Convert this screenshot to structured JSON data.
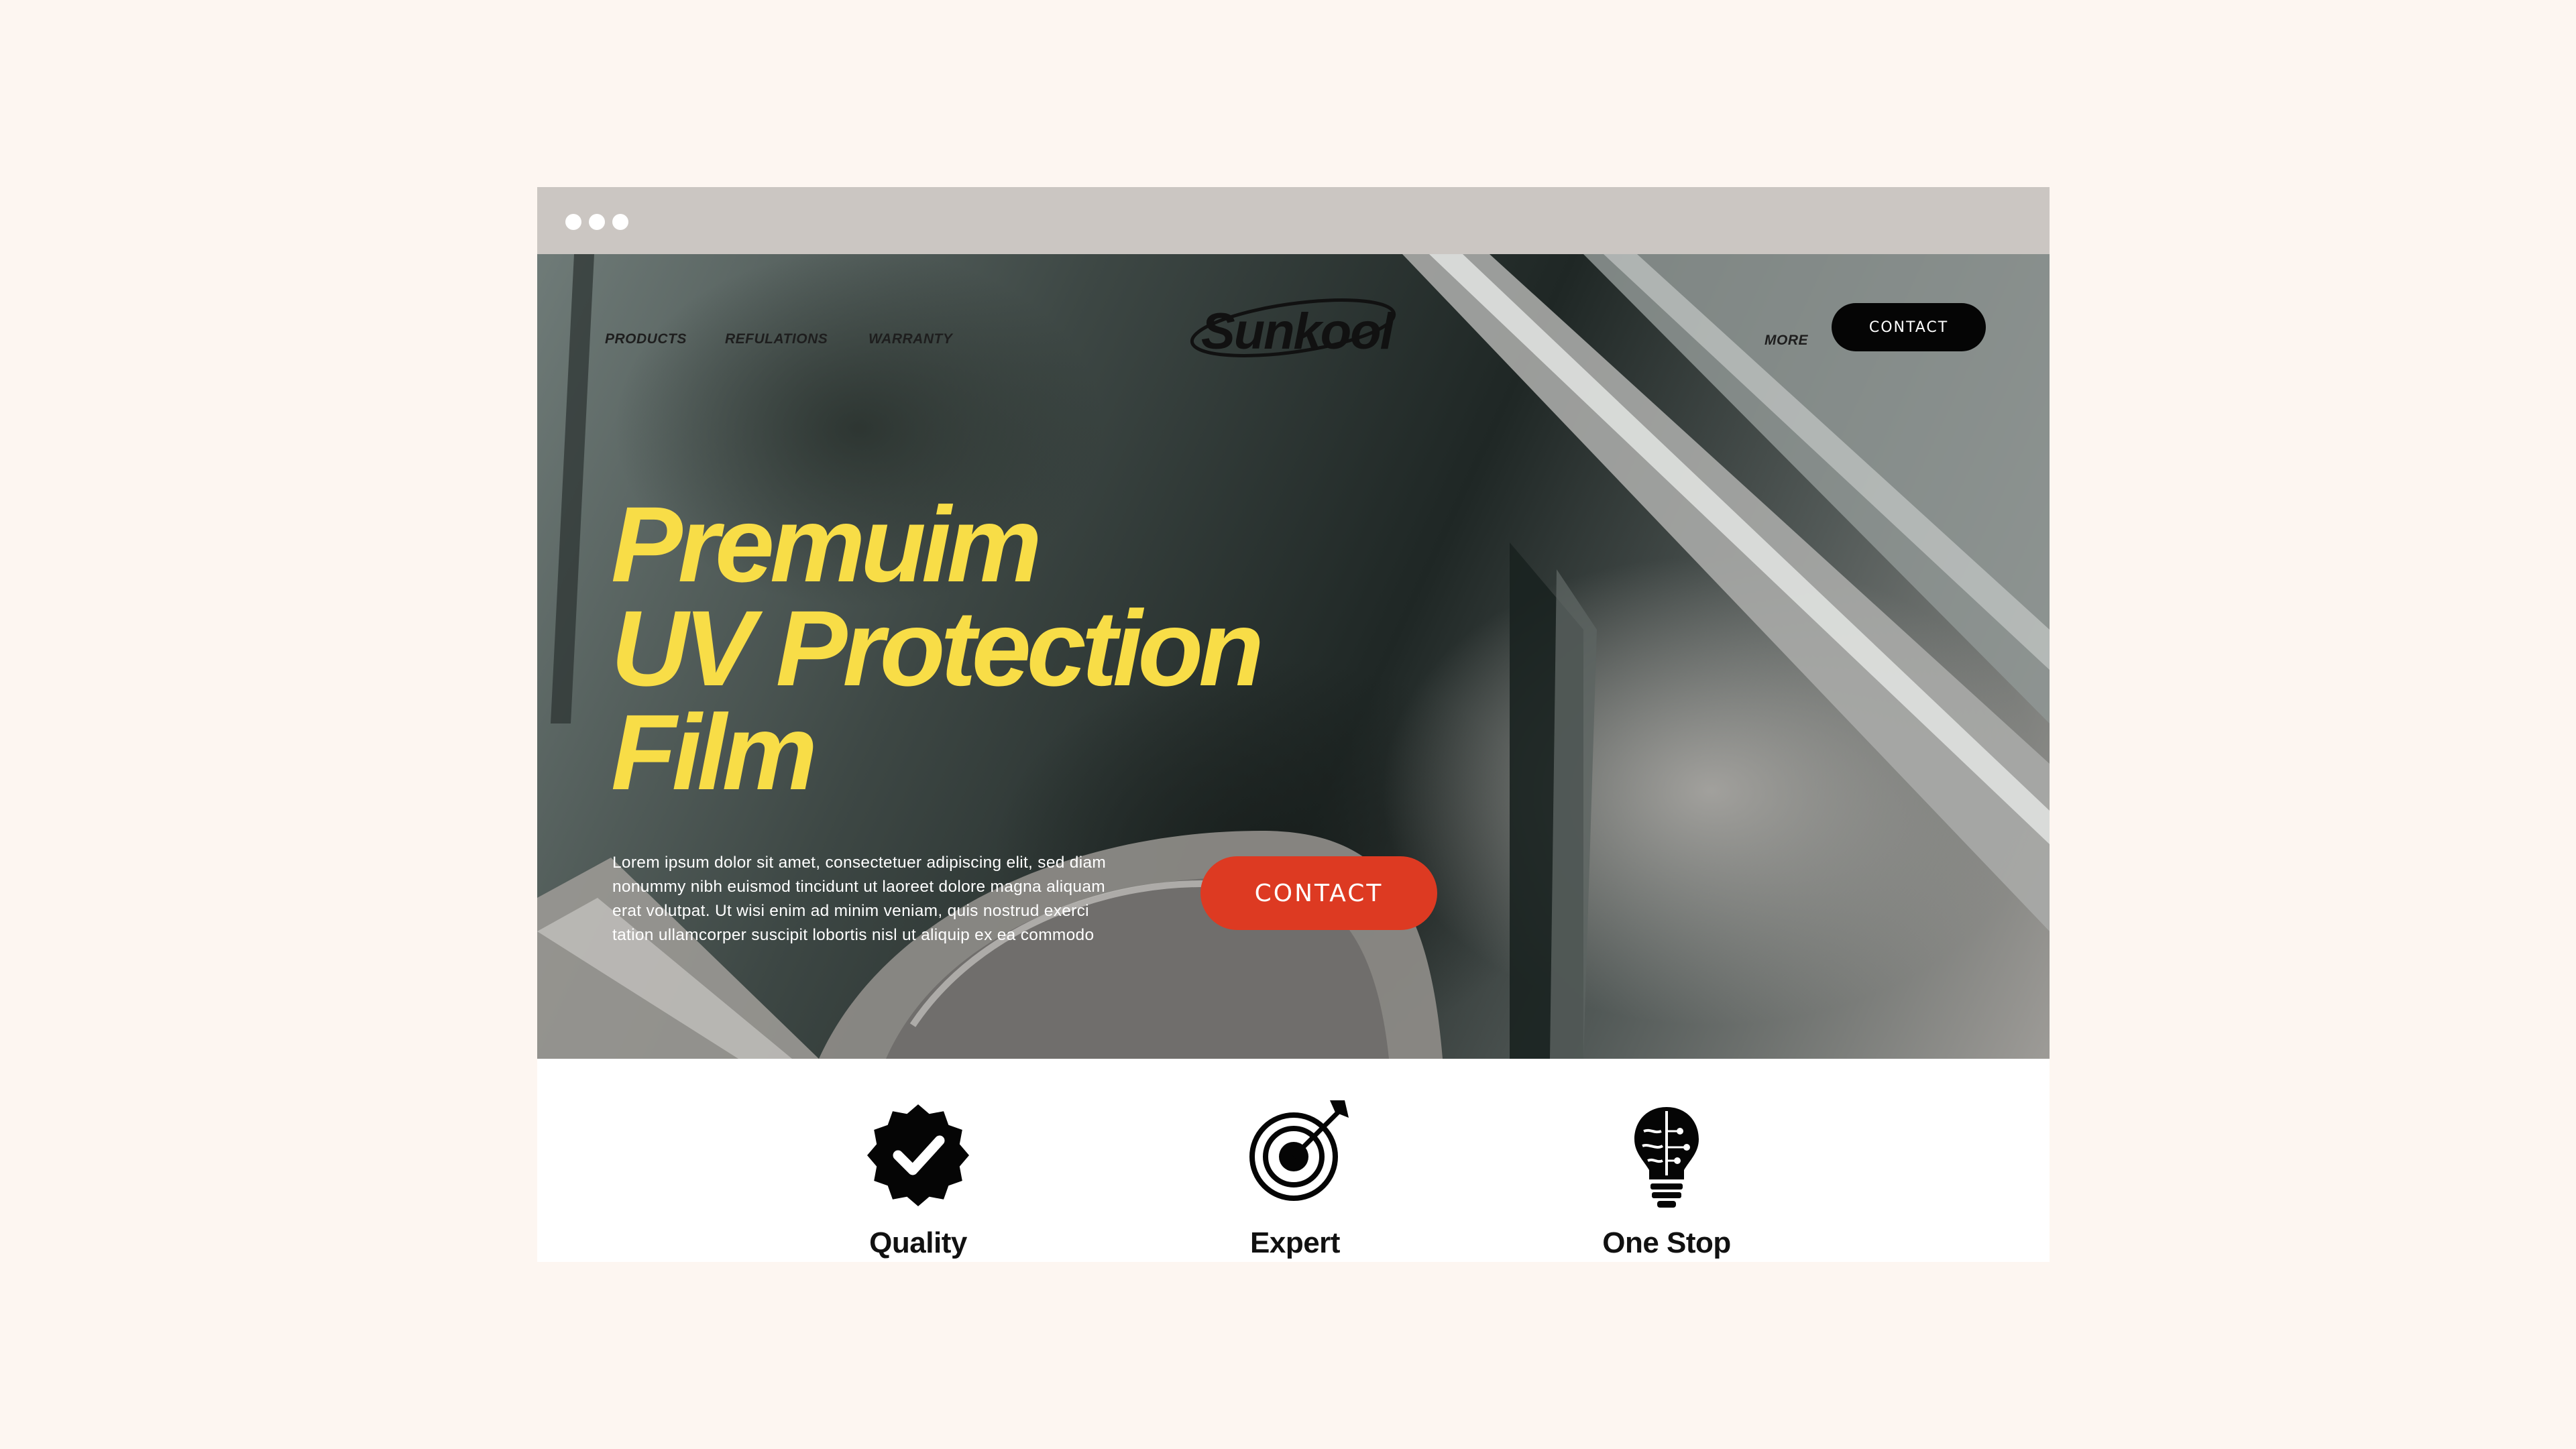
{
  "window": {
    "dots": [
      "dot",
      "dot",
      "dot"
    ]
  },
  "nav": {
    "left_links": [
      "PRODUCTS",
      "REFULATIONS",
      "WARRANTY"
    ],
    "logo": "Sunkool",
    "more_link": "MORE",
    "contact_button": "CONTACT"
  },
  "hero": {
    "headline_lines": [
      "Premuim",
      "UV Protection",
      "Film"
    ],
    "body_lines": [
      "Lorem ipsum dolor sit amet, consectetuer adipiscing elit, sed diam",
      "nonummy nibh euismod tincidunt ut laoreet dolore magna aliquam",
      "erat volutpat. Ut wisi enim ad minim veniam, quis nostrud exerci",
      "tation ullamcorper suscipit lobortis nisl ut aliquip ex ea commodo"
    ],
    "cta_button": "CONTACT"
  },
  "features": [
    {
      "label": "Quality",
      "icon": "verified-badge-icon"
    },
    {
      "label": "Expert",
      "icon": "target-arrow-icon"
    },
    {
      "label": "One Stop",
      "icon": "brain-lightbulb-icon"
    }
  ],
  "colors": {
    "page_background": "#fdf6f1",
    "titlebar": "#cbc6c2",
    "headline": "#f8dd47",
    "cta": "#dd3a22",
    "nav_button": "#050505"
  }
}
